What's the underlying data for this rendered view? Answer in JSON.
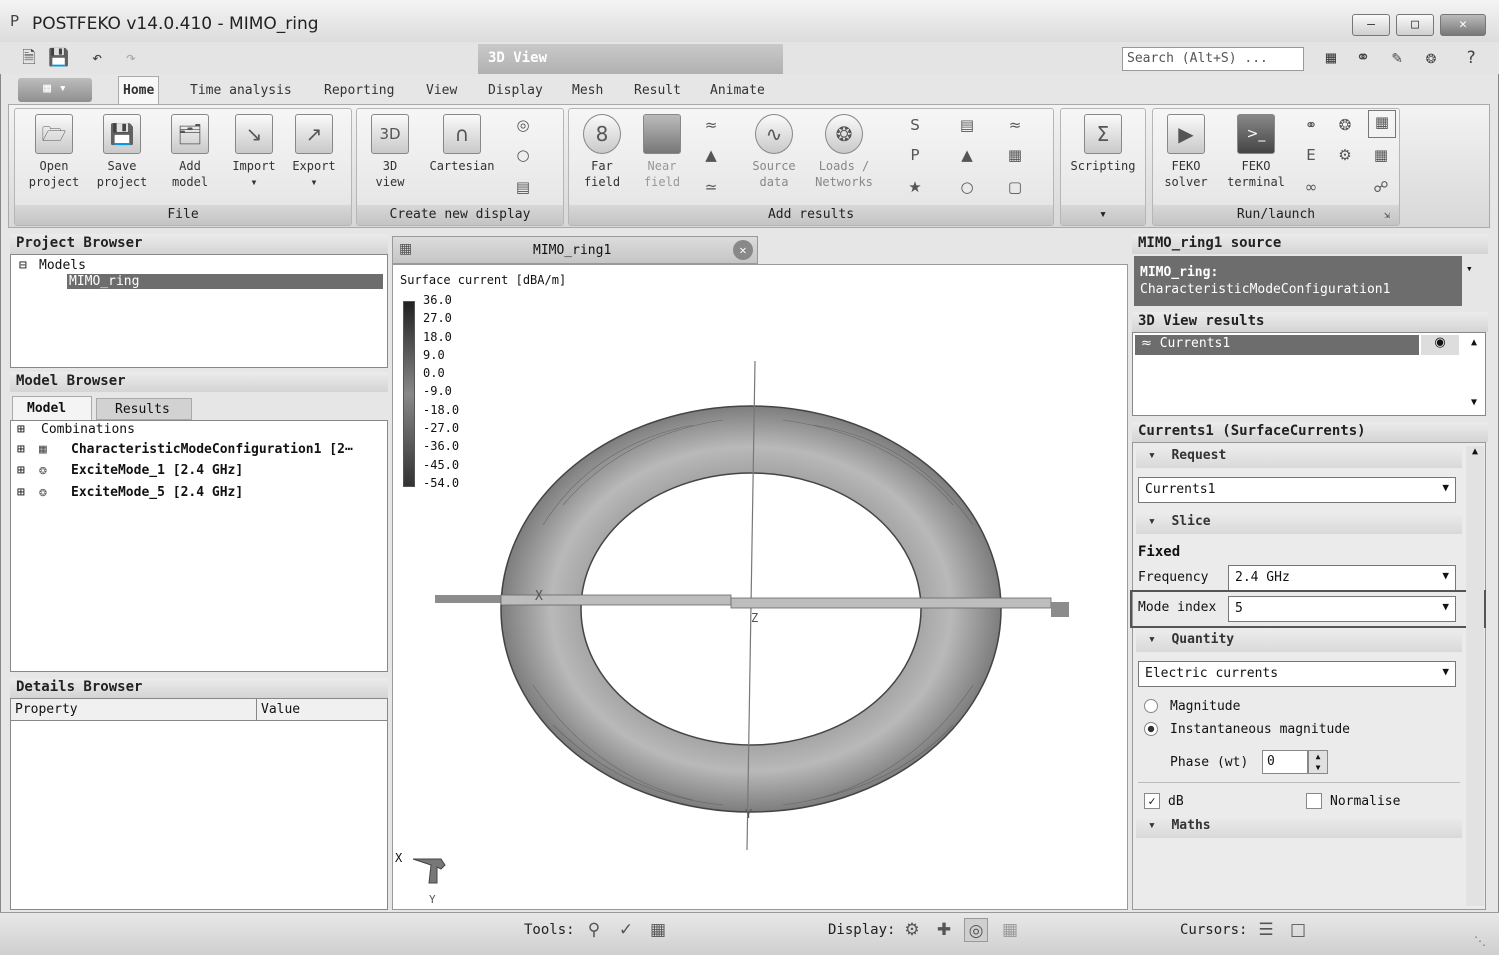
{
  "window": {
    "title": "POSTFEKO v14.0.410 - MIMO_ring"
  },
  "quick_access": {
    "context_tab": "3D View",
    "search_placeholder": "Search (Alt+S) ..."
  },
  "ribbon_tabs": [
    "Home",
    "Time analysis",
    "Reporting",
    "View",
    "Display",
    "Mesh",
    "Result",
    "Animate"
  ],
  "ribbon": {
    "file": {
      "label": "File",
      "open": "Open\nproject",
      "save": "Save\nproject",
      "add": "Add\nmodel",
      "import": "Import",
      "export": "Export"
    },
    "create": {
      "label": "Create new display",
      "view3d": "3D\nview",
      "cartesian": "Cartesian"
    },
    "add_results": {
      "label": "Add results",
      "far": "Far\nfield",
      "near": "Near\nfield",
      "source": "Source\ndata",
      "loads": "Loads /\nNetworks"
    },
    "scripting": {
      "label": "Scripting"
    },
    "run": {
      "label": "Run/launch",
      "solver": "FEKO\nsolver",
      "terminal": "FEKO\nterminal"
    }
  },
  "project_browser": {
    "title": "Project Browser",
    "root": "Models",
    "model": "MIMO_ring"
  },
  "model_browser": {
    "title": "Model Browser",
    "tabs": [
      "Model",
      "Results"
    ],
    "items": [
      "Combinations",
      "CharacteristicModeConfiguration1 [2⋯",
      "ExciteMode_1 [2.4 GHz]",
      "ExciteMode_5 [2.4 GHz]"
    ]
  },
  "details_browser": {
    "title": "Details Browser",
    "col_property": "Property",
    "col_value": "Value"
  },
  "view": {
    "tab_title": "MIMO_ring1",
    "legend_title": "Surface current [dBA/m]",
    "legend_values": [
      "36.0",
      "27.0",
      "18.0",
      "9.0",
      "0.0",
      "-9.0",
      "-18.0",
      "-27.0",
      "-36.0",
      "-45.0",
      "-54.0"
    ],
    "axis_x": "X",
    "axis_y": "Y",
    "axis_z": "Z",
    "tri_x": "X",
    "tri_y": "Y"
  },
  "right_panel": {
    "source_title": "MIMO_ring1 source",
    "source_line1": "MIMO_ring:",
    "source_line2": "CharacteristicModeConfiguration1",
    "results_title": "3D View results",
    "result_item": "Currents1",
    "props_title": "Currents1 (SurfaceCurrents)",
    "request_hdr": "Request",
    "request_value": "Currents1",
    "slice_hdr": "Slice",
    "fixed_label": "Fixed",
    "frequency_label": "Frequency",
    "frequency_value": "2.4 GHz",
    "mode_label": "Mode index",
    "mode_value": "5",
    "quantity_hdr": "Quantity",
    "quantity_value": "Electric currents",
    "magnitude": "Magnitude",
    "inst_magnitude": "Instantaneous magnitude",
    "phase_label": "Phase (wt)",
    "phase_value": "0",
    "db_label": "dB",
    "normalise_label": "Normalise",
    "maths_hdr": "Maths"
  },
  "statusbar": {
    "tools": "Tools:",
    "display": "Display:",
    "cursors": "Cursors:"
  }
}
